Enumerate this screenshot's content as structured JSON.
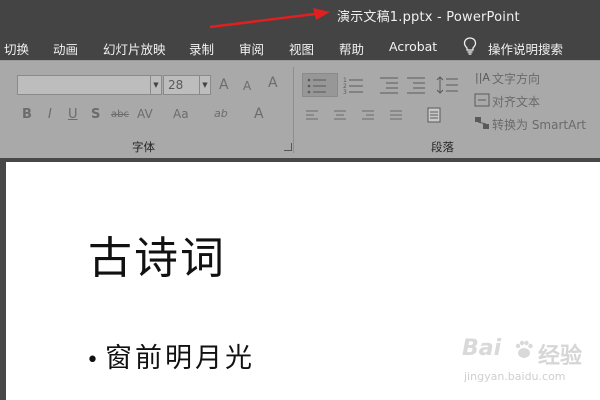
{
  "window": {
    "title": "演示文稿1.pptx  -  PowerPoint"
  },
  "tabs": [
    {
      "label": "切换"
    },
    {
      "label": "动画"
    },
    {
      "label": "幻灯片放映"
    },
    {
      "label": "录制"
    },
    {
      "label": "审阅"
    },
    {
      "label": "视图"
    },
    {
      "label": "帮助"
    },
    {
      "label": "Acrobat"
    },
    {
      "label": "操作说明搜索"
    }
  ],
  "ribbon": {
    "font_group": {
      "label": "字体",
      "font_name": "",
      "font_size": "28",
      "increase_label": "A",
      "decrease_label": "A",
      "clear_label": "A",
      "bold_label": "B",
      "italic_label": "I",
      "underline_label": "U",
      "shadow_label": "S",
      "strike_label": "abc",
      "spacing_label": "AV",
      "case_label": "Aa",
      "highlight_label": "ab",
      "color_label": "A"
    },
    "paragraph_group": {
      "label": "段落",
      "text_direction_label": "文字方向",
      "align_text_label": "对齐文本",
      "smartart_label": "转换为 SmartArt"
    }
  },
  "slide": {
    "title": "古诗词",
    "bullets": [
      "窗前明月光"
    ]
  },
  "watermark": {
    "brand": "Bai",
    "product": "经验",
    "url": "jingyan.baidu.com"
  },
  "colors": {
    "titlebar": "#444444",
    "ribbon": "#a9a9a9",
    "annotation_arrow": "#e0201f"
  },
  "icons": [
    "lightbulb-icon",
    "bullets-icon",
    "numbering-icon",
    "line-spacing-icon",
    "text-direction-icon",
    "align-text-icon",
    "smartart-icon",
    "columns-icon",
    "baidu-paw-icon"
  ]
}
